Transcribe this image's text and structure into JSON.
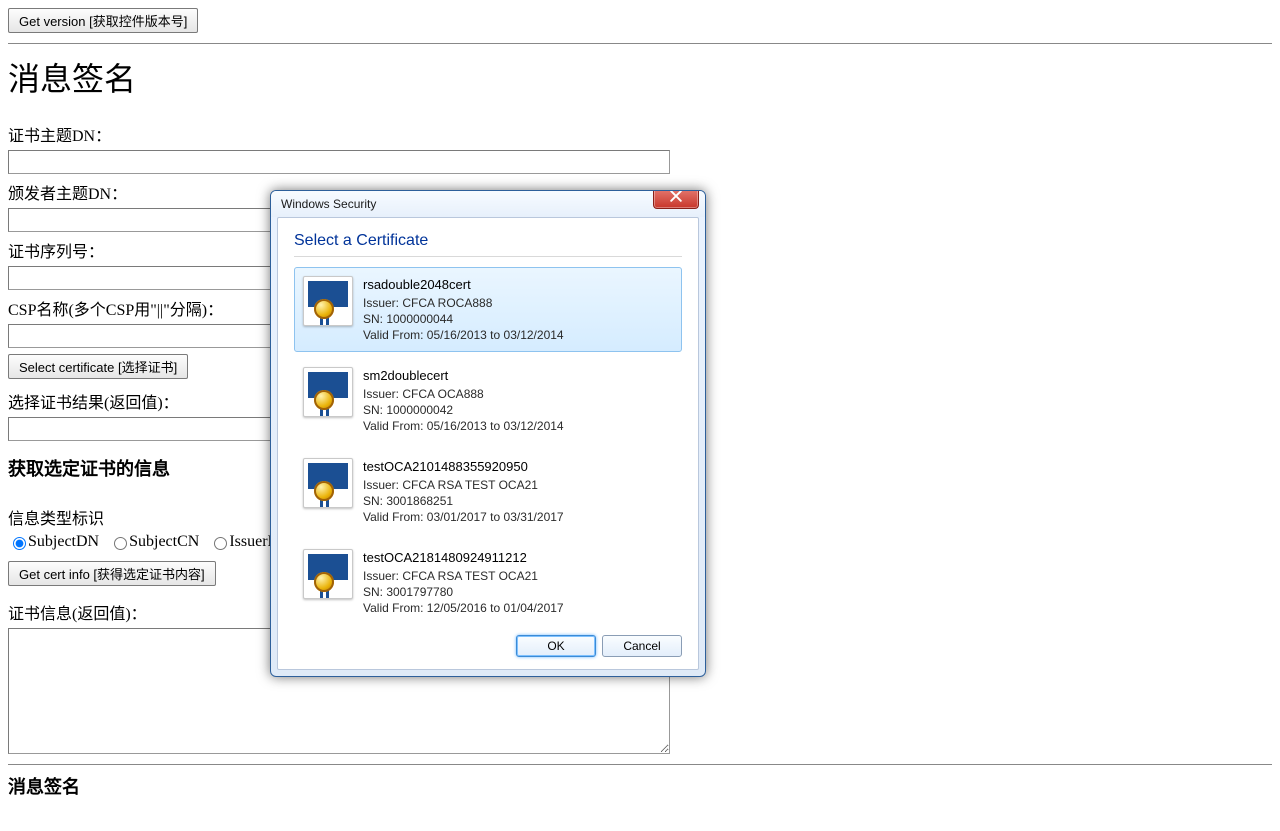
{
  "buttons": {
    "get_version": "Get version [获取控件版本号]",
    "select_cert": "Select certificate [选择证书]",
    "get_cert_info": "Get cert info [获得选定证书内容]"
  },
  "headings": {
    "msg_sign": "消息签名",
    "cert_info": "获取选定证书的信息",
    "msg_sign2": "消息签名"
  },
  "labels": {
    "subject_dn": "证书主题DN：",
    "issuer_dn": "颁发者主题DN：",
    "serial": "证书序列号：",
    "csp": "CSP名称(多个CSP用\"||\"分隔)：",
    "select_result": "选择证书结果(返回值)：",
    "info_type": "信息类型标识",
    "cert_info_result": "证书信息(返回值)："
  },
  "radios": {
    "subject_dn": "SubjectDN",
    "subject_cn": "SubjectCN",
    "issuer_dn": "IssuerDN"
  },
  "dialog": {
    "title": "Windows Security",
    "header": "Select a Certificate",
    "ok": "OK",
    "cancel": "Cancel",
    "certs": [
      {
        "name": "rsadouble2048cert",
        "issuer": "Issuer: CFCA ROCA888",
        "sn": "SN: 1000000044",
        "valid": "Valid From: 05/16/2013 to 03/12/2014",
        "selected": true
      },
      {
        "name": "sm2doublecert",
        "issuer": "Issuer: CFCA OCA888",
        "sn": "SN: 1000000042",
        "valid": "Valid From: 05/16/2013 to 03/12/2014",
        "selected": false
      },
      {
        "name": "testOCA2101488355920950",
        "issuer": "Issuer: CFCA RSA TEST OCA21",
        "sn": "SN: 3001868251",
        "valid": "Valid From: 03/01/2017 to 03/31/2017",
        "selected": false
      },
      {
        "name": "testOCA2181480924911212",
        "issuer": "Issuer: CFCA RSA TEST OCA21",
        "sn": "SN: 3001797780",
        "valid": "Valid From: 12/05/2016 to 01/04/2017",
        "selected": false
      }
    ]
  }
}
